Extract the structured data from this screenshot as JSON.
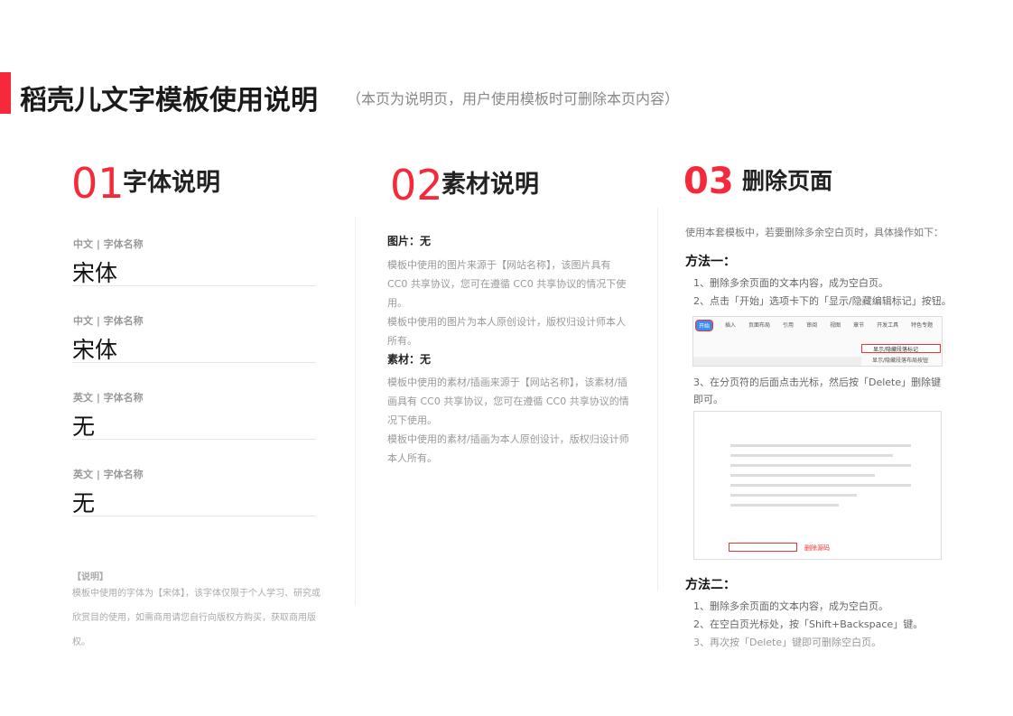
{
  "header": {
    "title": "稻壳儿文字模板使用说明",
    "subtitle": "（本页为说明页，用户使用模板时可删除本页内容）",
    "accent": "#f5293a"
  },
  "font_section": {
    "number": "01",
    "title": "字体说明",
    "items": [
      {
        "label": "中文 | 字体名称",
        "value": "宋体"
      },
      {
        "label": "中文 | 字体名称",
        "value": "宋体"
      },
      {
        "label": "英文 | 字体名称",
        "value": "无"
      },
      {
        "label": "英文 | 字体名称",
        "value": "无"
      }
    ],
    "note_title": "【说明】",
    "note": "模板中使用的字体为【宋体】，该字体仅限于个人学习、研究或欣赏目的使用，如需商用请您自行向版权方购买，获取商用版权。"
  },
  "material_section": {
    "number": "02",
    "title": "素材说明",
    "image_title": "图片：无",
    "image_text": [
      "模板中使用的图片来源于【网站名称】，该图片具有 CC0 共享协议，您可在遵循 CC0 共享协议的情况下使用。",
      "模板中使用的图片为本人原创设计，版权归设计师本人所有。"
    ],
    "asset_title": "素材：无",
    "asset_text": [
      "模板中使用的素材/插画来源于【网站名称】，该素材/插画具有 CC0 共享协议，您可在遵循 CC0 共享协议的情况下使用。",
      "模板中使用的素材/插画为本人原创设计，版权归设计师本人所有。"
    ]
  },
  "delete_section": {
    "number": "03",
    "title": "删除页面",
    "intro": "使用本套模板中，若要删除多余空白页时，具体操作如下：",
    "method1": "方法一：",
    "m1_steps": [
      "1、删除多余页面的文本内容，成为空白页。",
      "2、点击「开始」选项卡下的「显示/隐藏编辑标记」按钮。",
      "3、在分页符的后面点击光标，然后按「Delete」删除键即可。"
    ],
    "toolbar_tabs": [
      "开始",
      "插入",
      "页面布局",
      "引用",
      "审阅",
      "视图",
      "章节",
      "开发工具",
      "特色专题"
    ],
    "menu_items": [
      "显示/隐藏段落标记",
      "显示/隐藏段落布局按钮"
    ],
    "delete_label": "删除源码",
    "method2": "方法二：",
    "m2_steps": [
      "1、删除多余页面的文本内容，成为空白页。",
      "2、在空白页光标处，按「Shift+Backspace」键。",
      "3、再次按「Delete」键即可删除空白页。"
    ]
  }
}
